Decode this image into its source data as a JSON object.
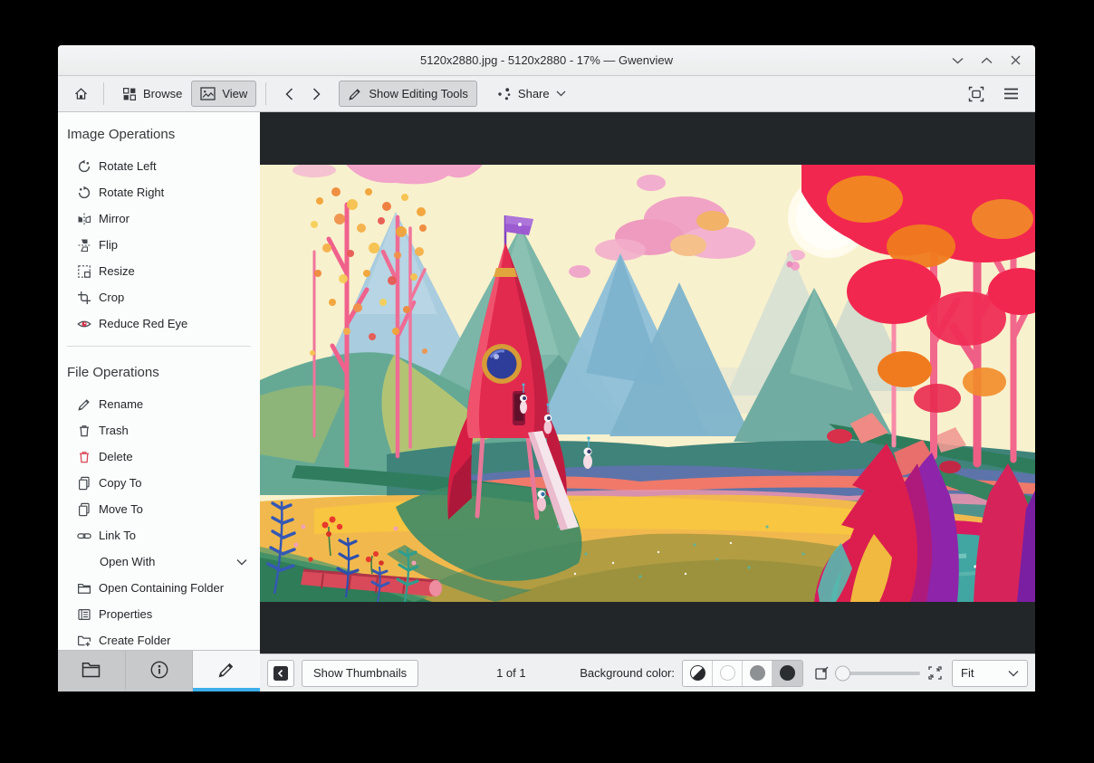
{
  "window": {
    "title": "5120x2880.jpg - 5120x2880 - 17% — Gwenview"
  },
  "toolbar": {
    "browse": "Browse",
    "view": "View",
    "show_editing_tools": "Show Editing Tools",
    "share": "Share"
  },
  "sidebar": {
    "sections": [
      {
        "title": "Image Operations",
        "items": [
          {
            "label": "Rotate Left",
            "icon": "rotate-left"
          },
          {
            "label": "Rotate Right",
            "icon": "rotate-right"
          },
          {
            "label": "Mirror",
            "icon": "mirror"
          },
          {
            "label": "Flip",
            "icon": "flip"
          },
          {
            "label": "Resize",
            "icon": "resize"
          },
          {
            "label": "Crop",
            "icon": "crop"
          },
          {
            "label": "Reduce Red Eye",
            "icon": "red-eye"
          }
        ]
      },
      {
        "title": "File Operations",
        "items": [
          {
            "label": "Rename",
            "icon": "rename"
          },
          {
            "label": "Trash",
            "icon": "trash"
          },
          {
            "label": "Delete",
            "icon": "delete"
          },
          {
            "label": "Copy To",
            "icon": "copy"
          },
          {
            "label": "Move To",
            "icon": "move"
          },
          {
            "label": "Link To",
            "icon": "link"
          },
          {
            "label": "Open With",
            "icon": null,
            "indent": true,
            "expander": true
          },
          {
            "label": "Open Containing Folder",
            "icon": "folder"
          },
          {
            "label": "Properties",
            "icon": "properties"
          },
          {
            "label": "Create Folder",
            "icon": "folder-new"
          }
        ]
      }
    ]
  },
  "statusbar": {
    "show_thumbnails": "Show Thumbnails",
    "page_indicator": "1 of 1",
    "background_color_label": "Background color:",
    "zoom_mode": "Fit"
  },
  "viewer": {
    "image_description": "Colorful illustration: red rocket with purple flag on a yellow field, teal mountains, pink clouds, red autumn trees and a teal pond"
  },
  "colors": {
    "accent": "#3daee9",
    "delete_red": "#da4453",
    "view_background": "#232629"
  }
}
